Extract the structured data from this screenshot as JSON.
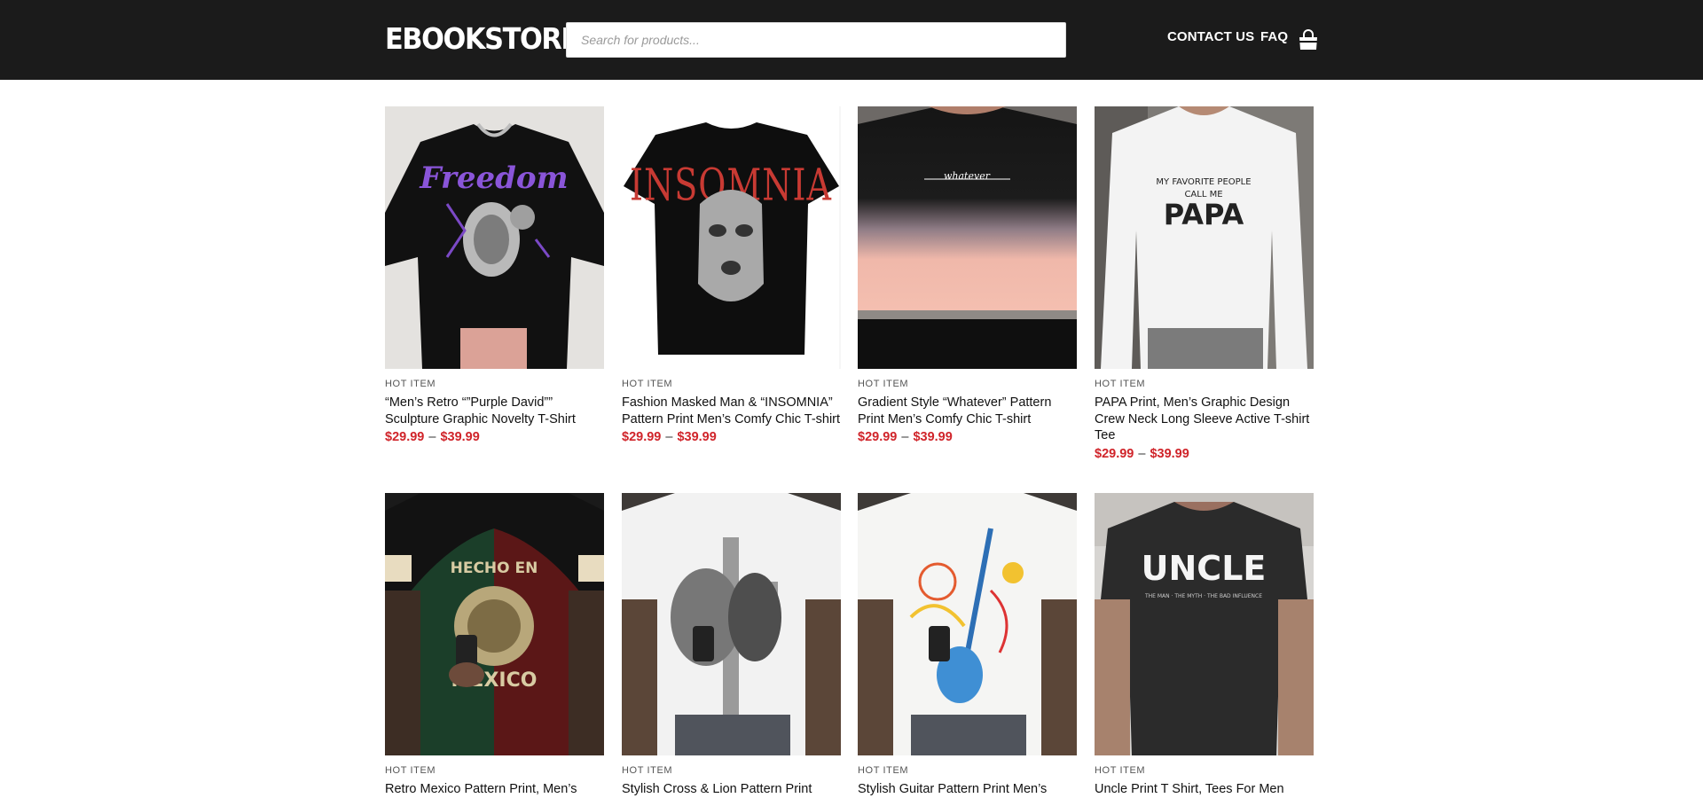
{
  "header": {
    "logo": "EBOOKSTORE",
    "search_placeholder": "Search for products...",
    "nav": [
      "CONTACT US",
      "FAQ"
    ],
    "cart_icon": "shopping-bag-icon"
  },
  "products": [
    {
      "category": "HOT ITEM",
      "title": "“Men’s Retro “”Purple David”” Sculpture Graphic Novelty T-Shirt",
      "price_min": "$29.99",
      "price_max": "$39.99",
      "image_print": "Freedom"
    },
    {
      "category": "HOT ITEM",
      "title": "Fashion Masked Man & “INSOMNIA” Pattern Print Men’s Comfy Chic T-shirt",
      "price_min": "$29.99",
      "price_max": "$39.99",
      "image_print": "INSOMNIA"
    },
    {
      "category": "HOT ITEM",
      "title": "Gradient Style “Whatever” Pattern Print Men’s Comfy Chic T-shirt",
      "price_min": "$29.99",
      "price_max": "$39.99",
      "image_print": "whatever"
    },
    {
      "category": "HOT ITEM",
      "title": "PAPA Print, Men’s Graphic Design Crew Neck Long Sleeve Active T-shirt Tee",
      "price_min": "$29.99",
      "price_max": "$39.99",
      "image_print": "MY FAVORITE PEOPLE CALL ME PAPA"
    },
    {
      "category": "HOT ITEM",
      "title": "Retro Mexico Pattern Print, Men’s",
      "price_min": "",
      "price_max": "",
      "image_print": "HECHO EN MEXICO"
    },
    {
      "category": "HOT ITEM",
      "title": "Stylish Cross & Lion Pattern Print",
      "price_min": "",
      "price_max": "",
      "image_print": ""
    },
    {
      "category": "HOT ITEM",
      "title": "Stylish Guitar Pattern Print Men’s",
      "price_min": "",
      "price_max": "",
      "image_print": ""
    },
    {
      "category": "HOT ITEM",
      "title": "Uncle Print T Shirt, Tees For Men",
      "price_min": "",
      "price_max": "",
      "image_print": "UNCLE"
    }
  ],
  "colors": {
    "header_bg": "#1b1b1b",
    "price": "#d0242a"
  }
}
